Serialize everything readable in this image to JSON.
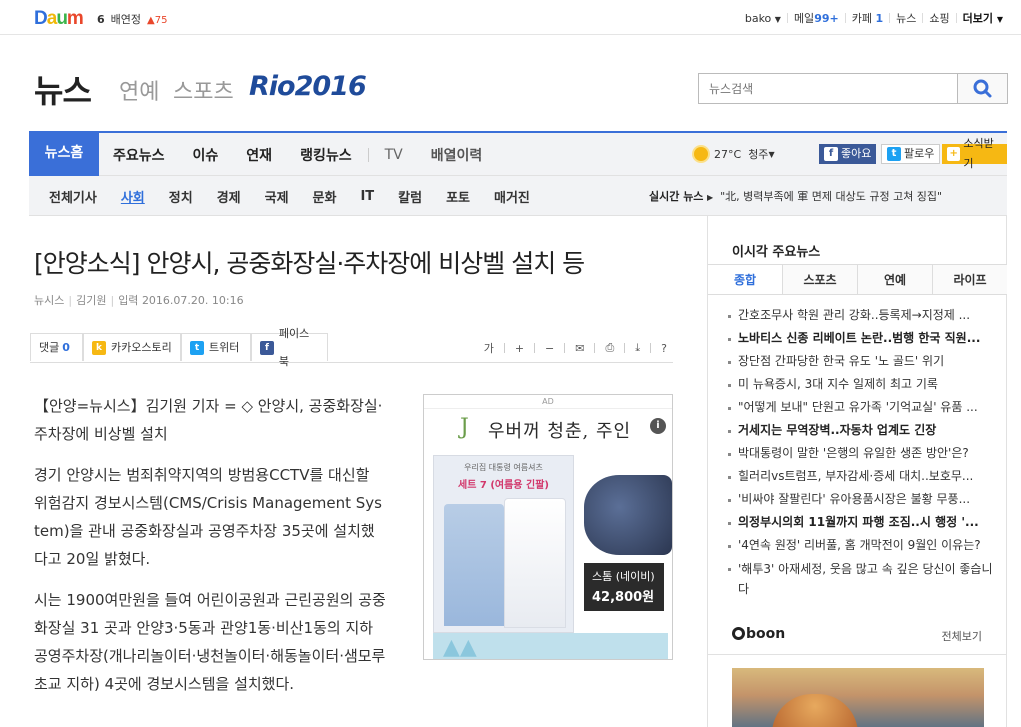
{
  "topbar": {
    "logo": [
      "D",
      "a",
      "u",
      "m"
    ],
    "trend_rank": "6",
    "trend_name": "배연정",
    "trend_change": "75",
    "user": "bako",
    "mail_label": "메일",
    "mail_count": "99+",
    "cafe_label": "카페",
    "cafe_count": "1",
    "news": "뉴스",
    "shopping": "쇼핑",
    "more": "더보기"
  },
  "header": {
    "brand": "뉴스",
    "sub1": "연예",
    "sub2": "스포츠",
    "rio": "Rio2016",
    "search_placeholder": "뉴스검색"
  },
  "nav": {
    "home": "뉴스홈",
    "tabs": [
      "주요뉴스",
      "이슈",
      "연재",
      "랭킹뉴스",
      "TV",
      "배열이력"
    ],
    "weather_temp": "27°C",
    "weather_city": "청주",
    "like": "좋아요",
    "follow": "팔로우",
    "subscribe": "소식받기"
  },
  "subnav": {
    "items": [
      "전체기사",
      "사회",
      "정치",
      "경제",
      "국제",
      "문화",
      "IT",
      "칼럼",
      "포토",
      "매거진"
    ],
    "realtime_label": "실시간 뉴스",
    "realtime_text": "\"北, 병력부족에 軍 면제 대상도 규정 고쳐 징집\""
  },
  "article": {
    "title": "[안양소식] 안양시, 공중화장실·주차장에 비상벨 설치 등",
    "source": "뉴시스",
    "author": "김기원",
    "date_label": "입력",
    "date": "2016.07.20. 10:16",
    "comments_label": "댓글",
    "comments_count": "0",
    "share_kakao": "카카오스토리",
    "share_twitter": "트위터",
    "share_facebook": "페이스북",
    "tools": [
      "가",
      "+",
      "−",
      "✉",
      "⎙",
      "⤓",
      "?"
    ],
    "paragraphs": [
      "【안양=뉴시스】김기원 기자 = ◇ 안양시, 공중화장실·주차장에 비상벨 설치",
      "경기 안양시는 범죄취약지역의 방범용CCTV를 대신할 위험감지 경보시스템(CMS/Crisis Management System)을 관내 공중화장실과 공영주차장 35곳에 설치했다고 20일 밝혔다.",
      "시는 1900여만원을 들여 어린이공원과 근린공원의 공중화장실 31 곳과 안양3·5동과 관양1동·비산1동의 지하공영주차장(개나리놀이터·냉천놀이터·해동놀이터·샘모루초교 지하) 4곳에 경보시스템을 설치했다."
    ]
  },
  "ad": {
    "label": "AD",
    "title": "우버꺼 청춘, 주인",
    "panel_line1": "우리집 대통령 여름셔츠",
    "panel_line2": "세트 7 (여름용 긴팔)",
    "product_name": "스톰 (네이비)",
    "product_price": "42,800원"
  },
  "sidebar": {
    "title": "이시각 주요뉴스",
    "tabs": [
      "종합",
      "스포츠",
      "연예",
      "라이프"
    ],
    "news": [
      {
        "text": "간호조무사 학원 관리 강화..등록제→지정제 ...",
        "bold": false
      },
      {
        "text": "노바티스 신종 리베이트 논란..범행 한국 직원...",
        "bold": true
      },
      {
        "text": "장단점 간파당한 한국 유도 '노 골드' 위기",
        "bold": false
      },
      {
        "text": "미 뉴욕증시, 3대 지수 일제히 최고 기록",
        "bold": false
      },
      {
        "text": "\"어떻게 보내\" 단원고 유가족 '기억교실' 유품 ...",
        "bold": false
      },
      {
        "text": "거세지는 무역장벽..자동차 업계도 긴장",
        "bold": true
      },
      {
        "text": "박대통령이 말한 '은행의 유일한 생존 방안'은?",
        "bold": false
      },
      {
        "text": "힐러리vs트럼프, 부자감세·증세 대치..보호무...",
        "bold": false
      },
      {
        "text": "'비싸야 잘팔린다' 유아용품시장은 불황 무풍...",
        "bold": false
      },
      {
        "text": "의정부시의회 11월까지 파행 조짐..시 행정 '...",
        "bold": true
      },
      {
        "text": "'4연속 원정' 리버풀, 홈 개막전이 9월인 이유는?",
        "bold": false
      },
      {
        "text": "'해투3' 아재세정, 웃음 많고 속 깊은 당신이 좋습니다",
        "bold": false,
        "wrap": true
      }
    ],
    "boon": "boon",
    "more": "전체보기"
  }
}
